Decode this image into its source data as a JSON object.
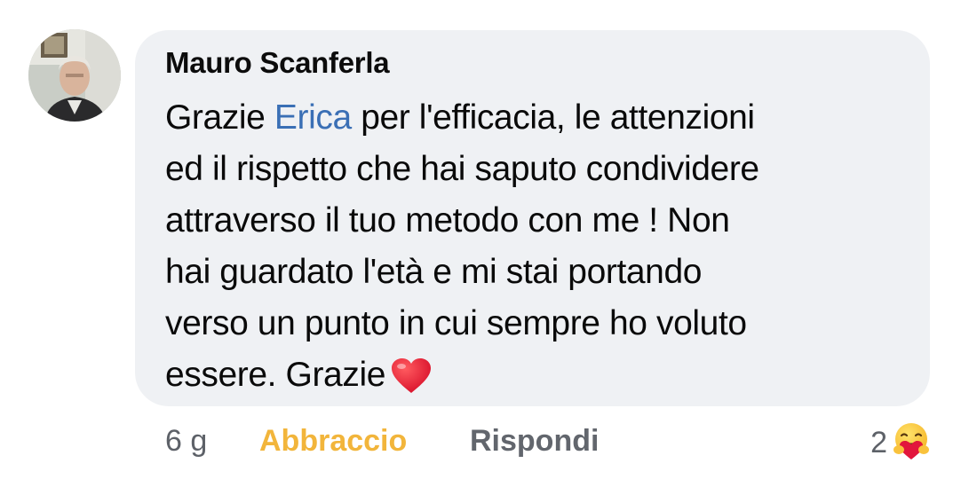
{
  "comment": {
    "author": "Mauro Scanferla",
    "lines": [
      {
        "pre": "Grazie ",
        "mention": "Erica",
        "post": " per l'efficacia, le attenzioni"
      },
      "ed il rispetto che hai saputo condividere",
      "attraverso il tuo metodo con me ! Non",
      "hai guardato l'età e mi stai portando",
      "verso un punto in cui sempre ho voluto",
      "essere. Grazie"
    ],
    "trailing_emoji": "heart-emoji",
    "bubble_color": "#eff1f4",
    "mention_color": "#3a6fb5"
  },
  "actions": {
    "time": "6 g",
    "reaction_label": "Abbraccio",
    "reaction_color": "#f2b53b",
    "reply_label": "Rispondi"
  },
  "reactions": {
    "count": "2",
    "icon": "care-hug-emoji"
  }
}
